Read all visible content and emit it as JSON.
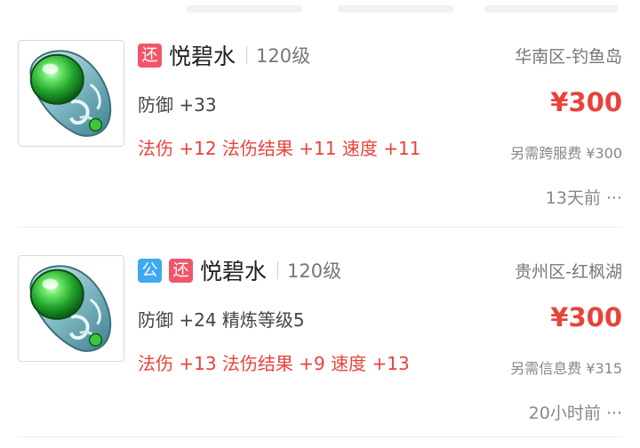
{
  "colors": {
    "price": "#e8433a",
    "badge_huan": "#f0566a",
    "badge_gong": "#3ea8f3",
    "jade": "#2fbf3a"
  },
  "listings": [
    {
      "image_icon": "jade-ring-icon",
      "badges": [
        "还"
      ],
      "name": "悦碧水",
      "level": "120级",
      "stats": "防御 +33",
      "attributes": "法伤 +12 法伤结果 +11 速度 +11",
      "region": "华南区-钓鱼岛",
      "price": "¥300",
      "fee": "另需跨服费 ¥300",
      "time": "13天前 ···"
    },
    {
      "image_icon": "jade-ring-icon",
      "badges": [
        "公",
        "还"
      ],
      "name": "悦碧水",
      "level": "120级",
      "stats": "防御 +24 精炼等级5",
      "attributes": "法伤 +13 法伤结果 +9 速度 +13",
      "region": "贵州区-红枫湖",
      "price": "¥300",
      "fee": "另需信息费 ¥315",
      "time": "20小时前 ···"
    }
  ]
}
